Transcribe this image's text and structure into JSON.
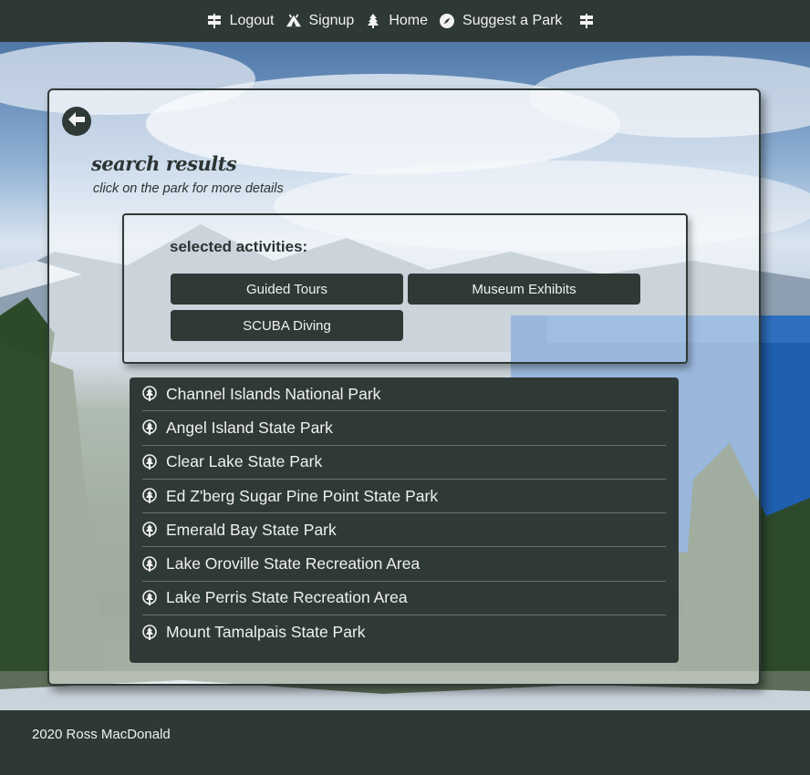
{
  "nav": {
    "items": [
      {
        "label": "Logout",
        "icon": "signpost-icon"
      },
      {
        "label": "Signup",
        "icon": "tent-icon"
      },
      {
        "label": "Home",
        "icon": "tree-icon"
      },
      {
        "label": "Suggest a Park",
        "icon": "compass-icon"
      }
    ],
    "end_icon": "signpost-icon"
  },
  "card": {
    "back_icon": "back-arrow-icon",
    "title": "search results",
    "subtitle": "click on the park for more details",
    "activities_heading": "selected activities:",
    "activities": [
      "Guided Tours",
      "Museum Exhibits",
      "SCUBA Diving"
    ],
    "results": [
      "Channel Islands National Park",
      "Angel Island State Park",
      "Clear Lake State Park",
      "Ed Z'berg Sugar Pine Point State Park",
      "Emerald Bay State Park",
      "Lake Oroville State Recreation Area",
      "Lake Perris State Recreation Area",
      "Mount Tamalpais State Park"
    ],
    "result_icon": "tree-badge-icon"
  },
  "footer": {
    "text": "2020 Ross MacDonald"
  },
  "colors": {
    "dark": "#2f3a37",
    "light_text": "#f0f0f0"
  }
}
